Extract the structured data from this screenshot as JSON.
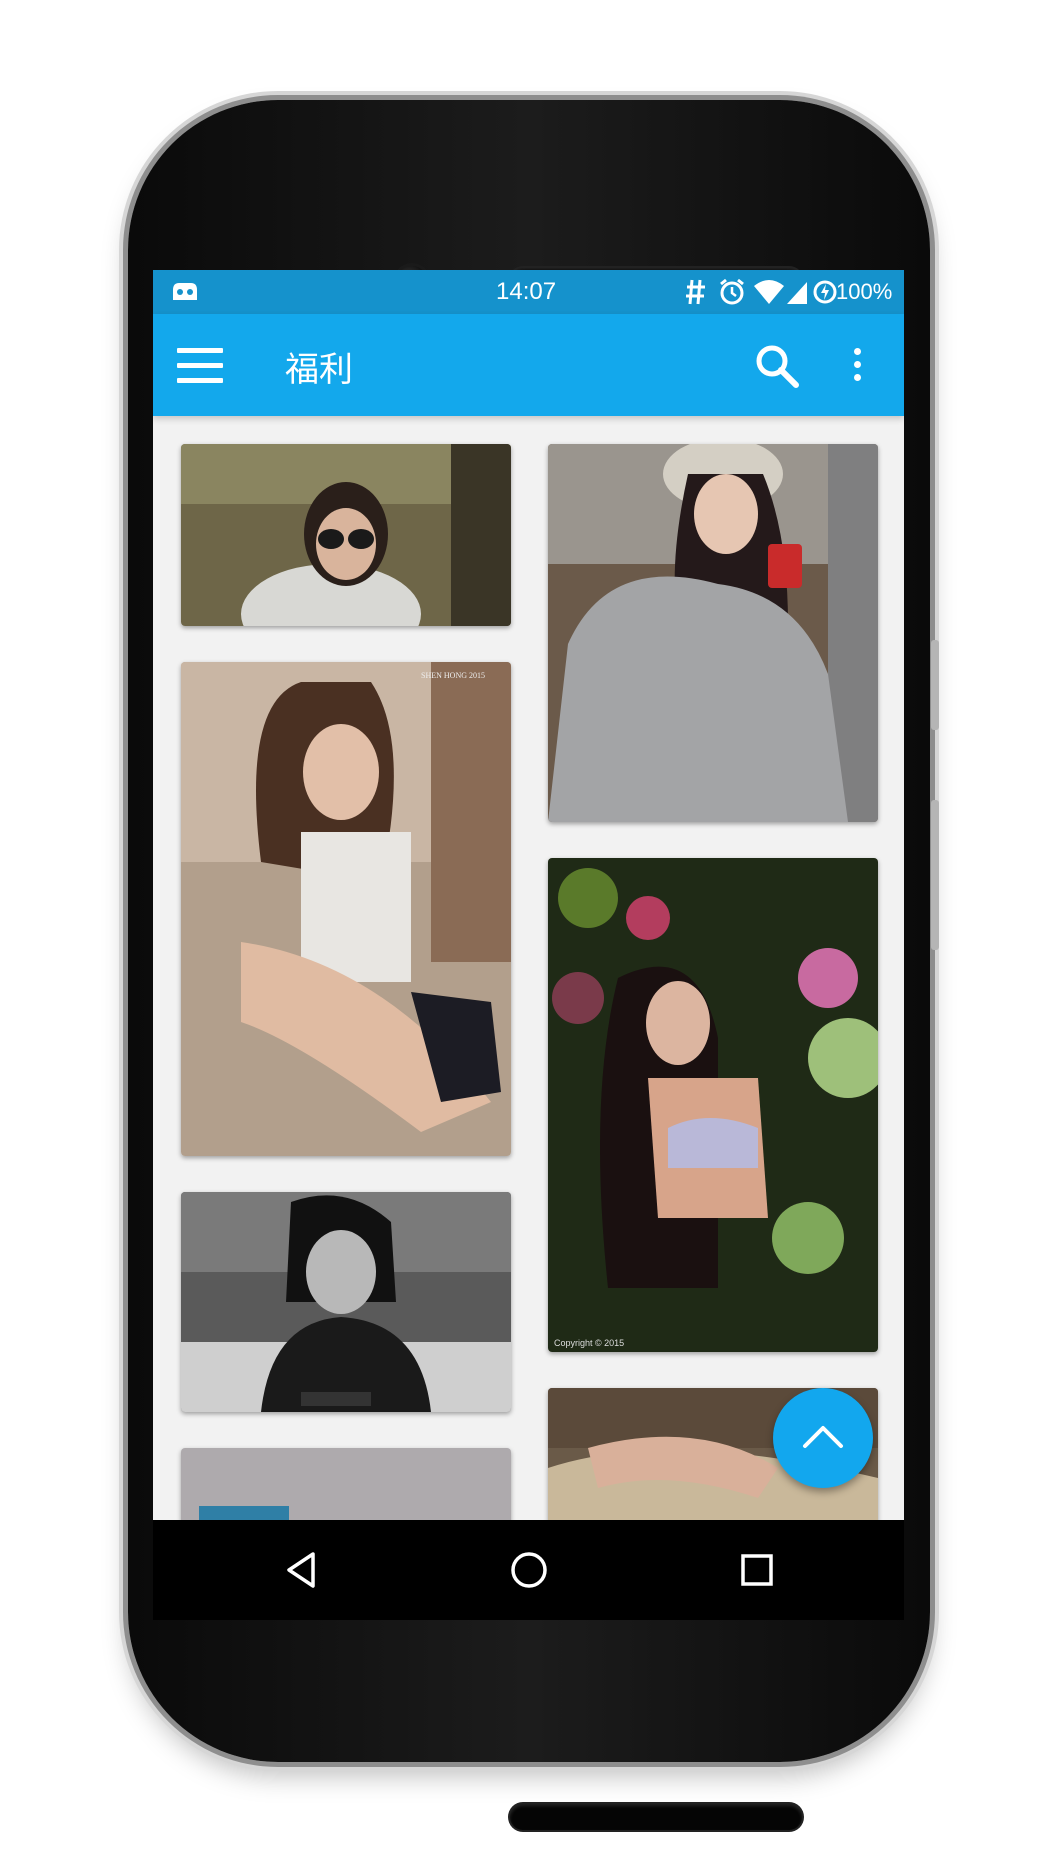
{
  "status_bar": {
    "time": "14:07",
    "battery_percent": "100%",
    "icons": [
      "cyanogen-mod-icon",
      "hash-icon",
      "alarm-icon",
      "wifi-icon",
      "signal-icon",
      "battery-charging-icon"
    ]
  },
  "app_bar": {
    "title": "福利",
    "icons": [
      "menu-icon",
      "search-icon",
      "more-vert-icon"
    ]
  },
  "gallery": {
    "cards": [
      {
        "column": "left",
        "subject": "woman with aviator sunglasses"
      },
      {
        "column": "left",
        "subject": "woman sitting on sofa",
        "caption": "SHEN HONG 2015"
      },
      {
        "column": "left",
        "subject": "black and white portrait on bed"
      },
      {
        "column": "left",
        "subject": "partially loaded image"
      },
      {
        "column": "right",
        "subject": "woman in knit cap with red cup"
      },
      {
        "column": "right",
        "subject": "woman among flowers",
        "caption": "Copyright © 2015"
      },
      {
        "column": "right",
        "subject": "woman lying in floral dress"
      }
    ]
  },
  "fab": {
    "icon": "chevron-up-icon"
  },
  "nav_bar": {
    "icons": [
      "back-icon",
      "home-icon",
      "recents-icon"
    ]
  },
  "colors": {
    "status_bar": "#1592cc",
    "app_bar": "#13a8ec",
    "fab": "#12a7ee",
    "background": "#f2f2f2"
  }
}
